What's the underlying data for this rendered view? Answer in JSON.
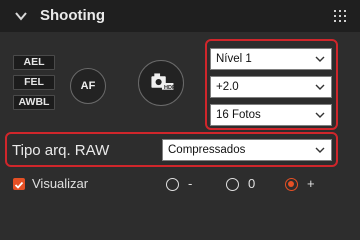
{
  "panel": {
    "title": "Shooting",
    "collapse_icon": "chevron-down-icon",
    "menu_icon": "grid-dots-icon"
  },
  "lock_buttons": {
    "ael": "AEL",
    "fel": "FEL",
    "awbl": "AWBL"
  },
  "af_button": {
    "label": "AF"
  },
  "hdr_button": {
    "label": "HDR",
    "icon": "hdr-camera-icon"
  },
  "bracketing": {
    "level": "Nível 1",
    "exposure": "+2.0",
    "count": "16 Fotos"
  },
  "raw": {
    "label": "Tipo arq. RAW",
    "value": "Compressados"
  },
  "preview": {
    "label": "Visualizar",
    "checked": true,
    "options": [
      {
        "label": "-",
        "selected": false
      },
      {
        "label": "0",
        "selected": false
      },
      {
        "label": "+",
        "selected": true
      }
    ]
  },
  "colors": {
    "highlight": "#d0262b",
    "accent": "#e55025",
    "header_bg": "#1f1f1f",
    "panel_bg": "#2d2d2d"
  }
}
